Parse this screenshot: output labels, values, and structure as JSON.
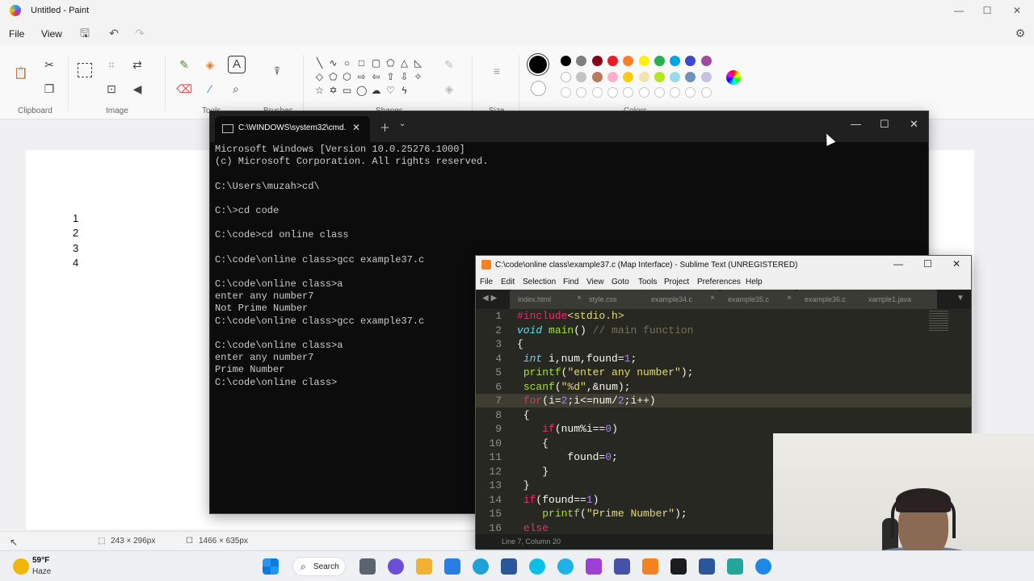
{
  "paint": {
    "title": "Untitled - Paint",
    "menu": [
      "File",
      "View"
    ],
    "groups": {
      "clipboard": "Clipboard",
      "image": "Image",
      "tools": "Tools",
      "brushes": "Brushes",
      "shapes": "Shapes",
      "size": "Size",
      "colors": "Colors"
    },
    "canvas_lines": [
      "1",
      "2",
      "3",
      "4"
    ],
    "status": {
      "selection_size": "243 × 296px",
      "canvas_size": "1466 × 635px"
    },
    "colors": {
      "row1": [
        "#000000",
        "#7f7f7f",
        "#880015",
        "#ed1c24",
        "#ff7f27",
        "#fff200",
        "#22b14c",
        "#00a2e8",
        "#3f48cc",
        "#a349a4"
      ],
      "row2": [
        "#ffffff",
        "#c3c3c3",
        "#b97a57",
        "#ffaec9",
        "#ffc90e",
        "#efe4b0",
        "#b5e61d",
        "#99d9ea",
        "#7092be",
        "#c8bfe7"
      ]
    }
  },
  "terminal": {
    "tab_title": "C:\\WINDOWS\\system32\\cmd.",
    "lines": [
      "Microsoft Windows [Version 10.0.25276.1000]",
      "(c) Microsoft Corporation. All rights reserved.",
      "",
      "C:\\Users\\muzah>cd\\",
      "",
      "C:\\>cd code",
      "",
      "C:\\code>cd online class",
      "",
      "C:\\code\\online class>gcc example37.c",
      "",
      "C:\\code\\online class>a",
      "enter any number7",
      "Not Prime Number",
      "C:\\code\\online class>gcc example37.c",
      "",
      "C:\\code\\online class>a",
      "enter any number7",
      "Prime Number",
      "C:\\code\\online class>"
    ]
  },
  "sublime": {
    "title": "C:\\code\\online class\\example37.c (Map Interface) - Sublime Text (UNREGISTERED)",
    "menu": [
      "File",
      "Edit",
      "Selection",
      "Find",
      "View",
      "Goto",
      "Tools",
      "Project",
      "Preferences",
      "Help"
    ],
    "tabs": [
      "index.html",
      "style.css",
      "example34.c",
      "example35.c",
      "example36.c",
      "xample1.java"
    ],
    "line_numbers": [
      "1",
      "2",
      "3",
      "4",
      "5",
      "6",
      "7",
      "8",
      "9",
      "10",
      "11",
      "12",
      "13",
      "14",
      "15",
      "16"
    ],
    "status": "Line 7, Column 20"
  },
  "taskbar": {
    "temp": "59°F",
    "weather": "Haze",
    "search_label": "Search"
  }
}
